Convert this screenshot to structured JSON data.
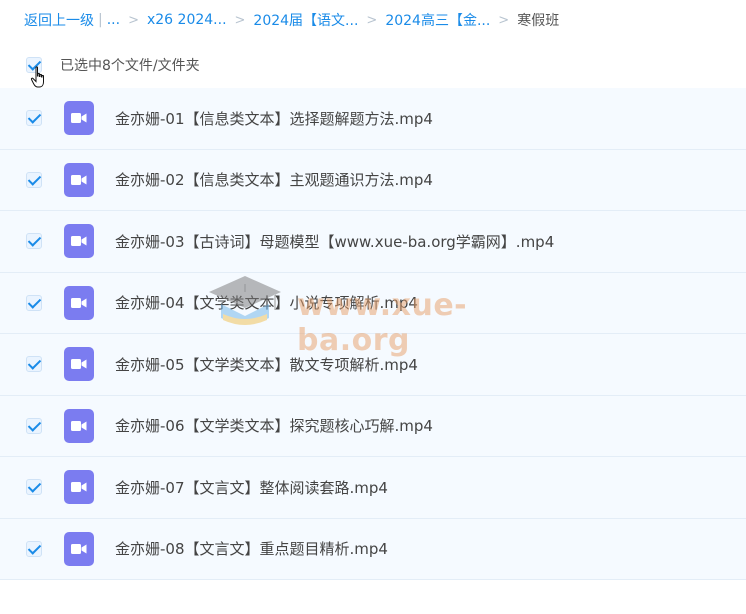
{
  "breadcrumb": {
    "back": "返回上一级",
    "pipe": "|",
    "ellipsis": "...",
    "items": [
      "x26 2024...",
      "2024届【语文...",
      "2024高三【金..."
    ],
    "current": "寒假班"
  },
  "selection": {
    "label": "已选中8个文件/文件夹"
  },
  "files": [
    "金亦姗-01【信息类文本】选择题解题方法.mp4",
    "金亦姗-02【信息类文本】主观题通识方法.mp4",
    "金亦姗-03【古诗词】母题模型【www.xue-ba.org学霸网】.mp4",
    "金亦姗-04【文学类文本】小说专项解析.mp4",
    "金亦姗-05【文学类文本】散文专项解析.mp4",
    "金亦姗-06【文学类文本】探究题核心巧解.mp4",
    "金亦姗-07【文言文】整体阅读套路.mp4",
    "金亦姗-08【文言文】重点题目精析.mp4"
  ],
  "watermark": "www.xue-ba.org",
  "colors": {
    "accent": "#1a8be8",
    "video_icon": "#7b7cf0",
    "row_bg": "#f5faff"
  },
  "icons": {
    "file": "video-file-icon",
    "checkbox": "checkmark-icon",
    "cursor": "hand-pointer-icon",
    "watermark": "graduation-cap-icon"
  }
}
